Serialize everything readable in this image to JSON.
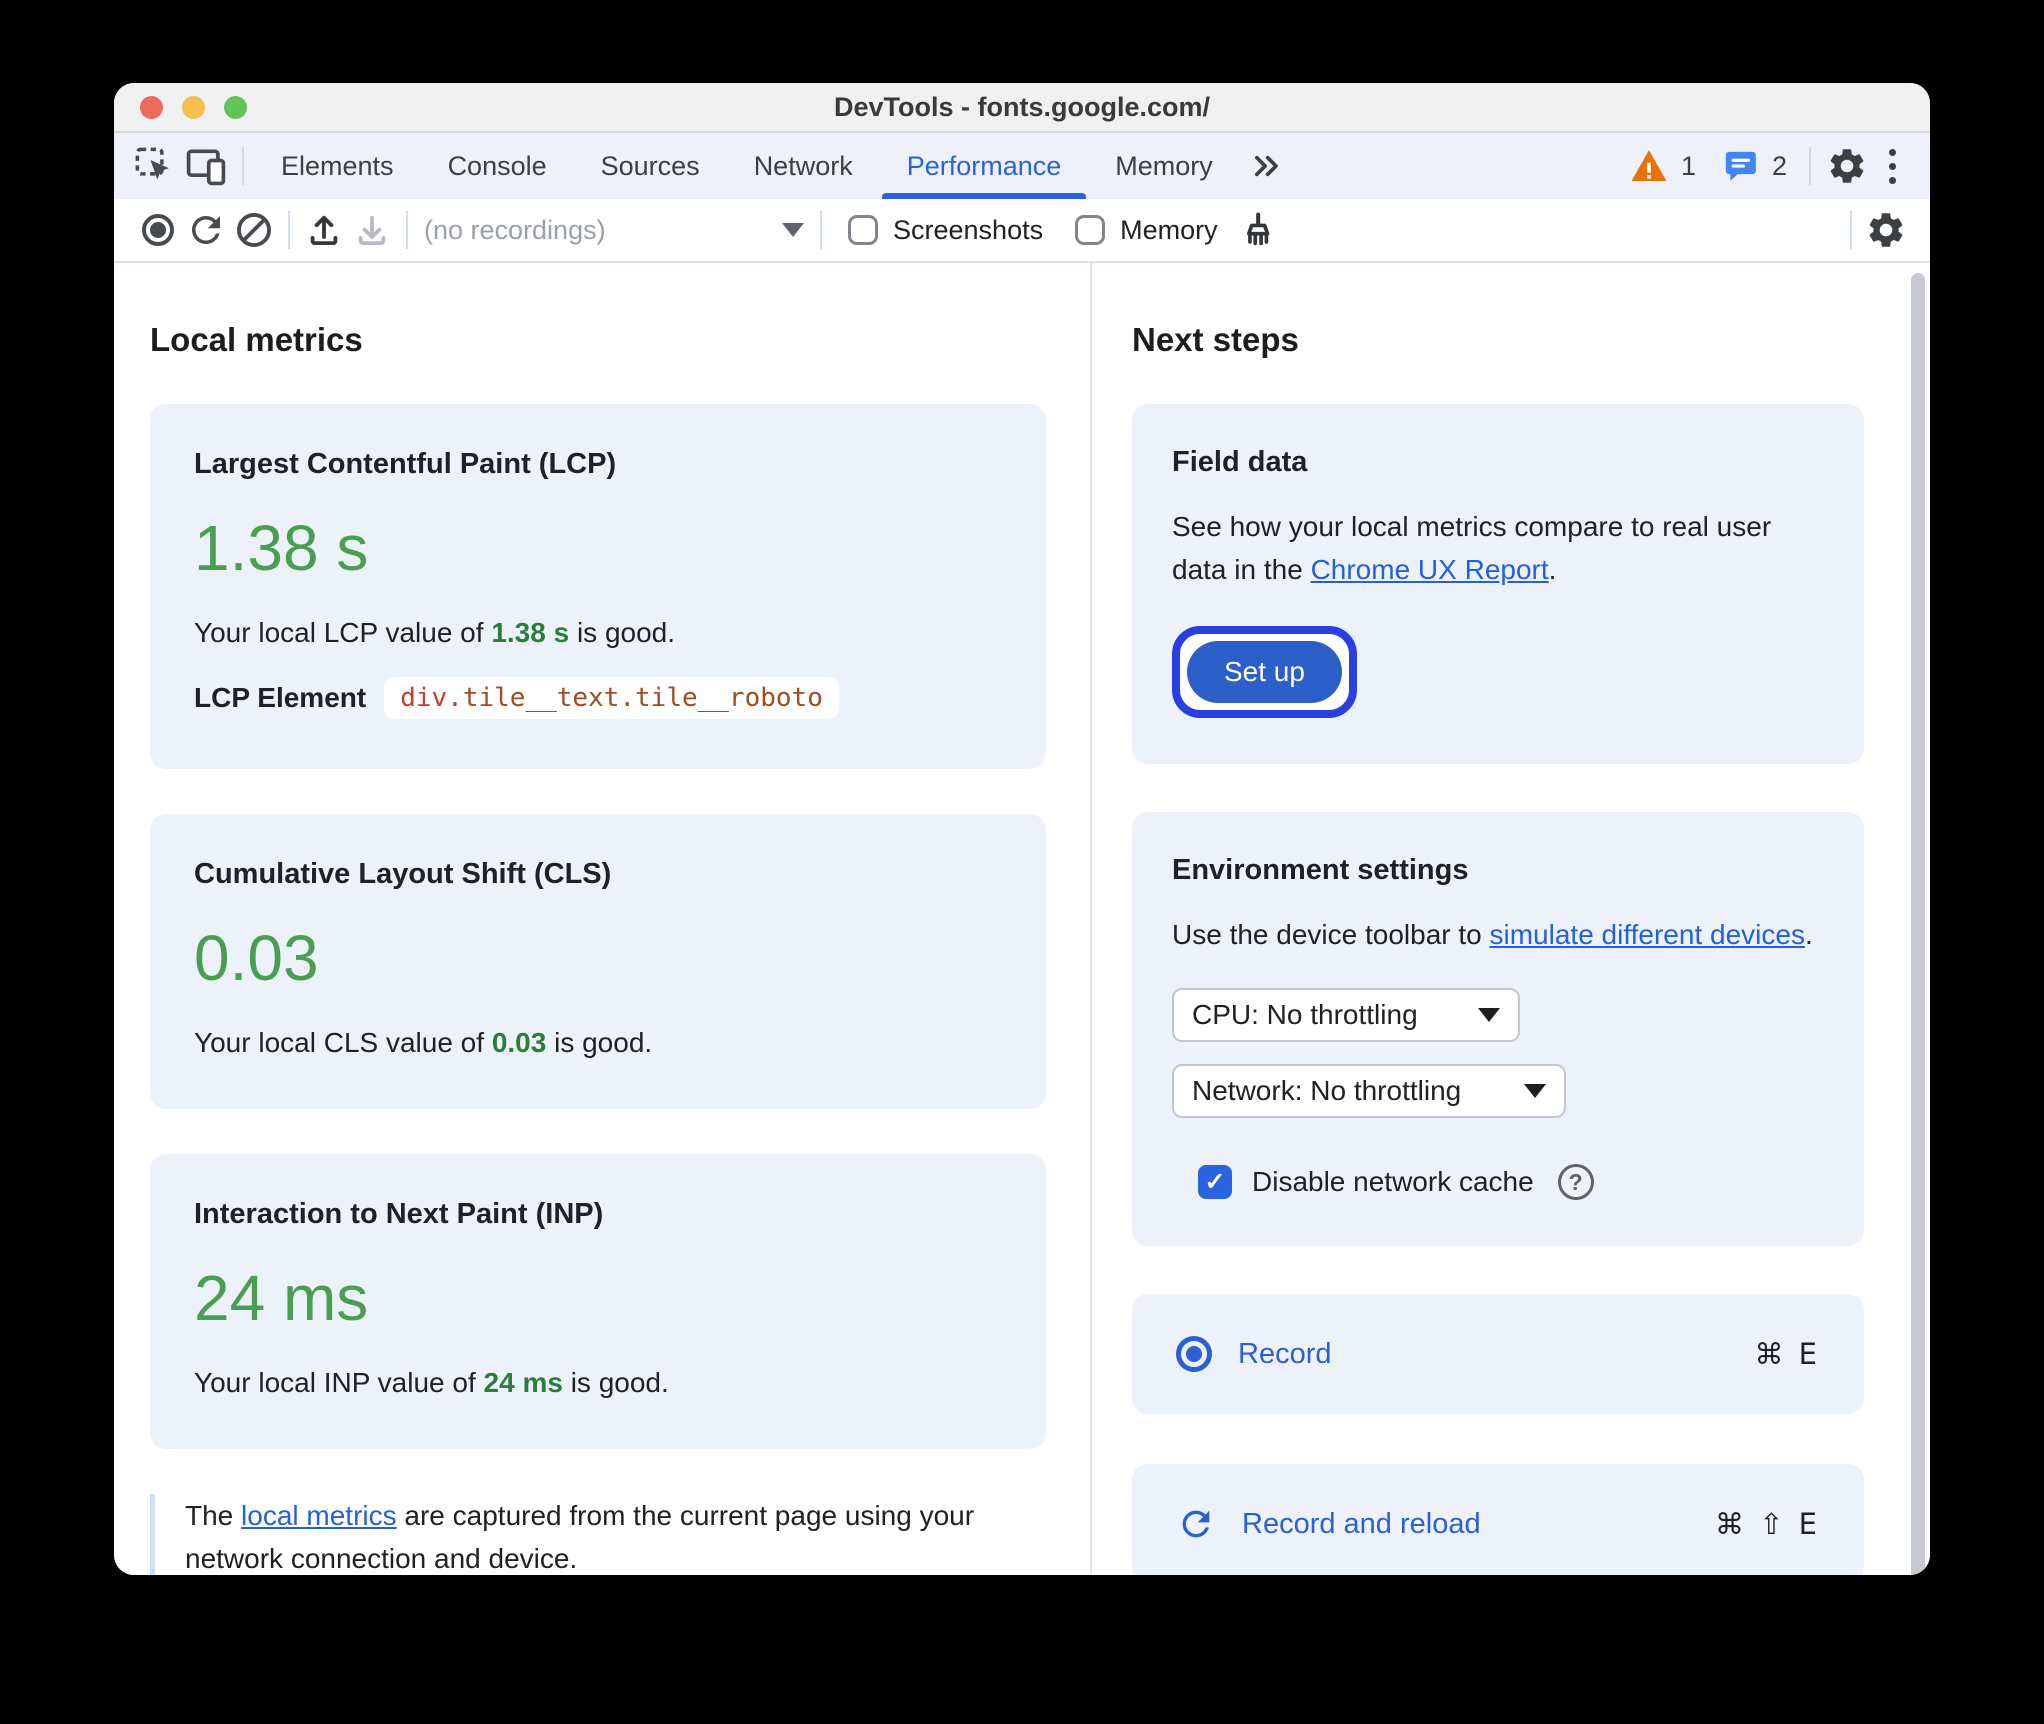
{
  "colors": {
    "tab_blue": "#2b62e0",
    "link_blue": "#2360e0",
    "action_blue": "#2c5fd0",
    "button_blue": "#2d5fc8",
    "focus_ring": "#2840e0",
    "value_green": "#4a9e52",
    "inline_green": "#2d7d3a",
    "warning_orange": "#e8710a",
    "issue_blue": "#4285f4",
    "selector_tag": "#c53e36",
    "selector_class": "#a04d21",
    "checkbox_blue": "#2a64e0",
    "card_bg": "#edf2fa"
  },
  "window": {
    "title": "DevTools - fonts.google.com/"
  },
  "tabbar": {
    "tabs": [
      {
        "label": "Elements"
      },
      {
        "label": "Console"
      },
      {
        "label": "Sources"
      },
      {
        "label": "Network"
      },
      {
        "label": "Performance"
      },
      {
        "label": "Memory"
      }
    ],
    "warning_count": "1",
    "issue_count": "2"
  },
  "toolbar": {
    "recordings_placeholder": "(no recordings)",
    "screenshots_label": "Screenshots",
    "memory_label": "Memory"
  },
  "icons": {
    "help_glyph": "?",
    "check_glyph": "✓"
  },
  "local_metrics": {
    "heading": "Local metrics",
    "lcp": {
      "title": "Largest Contentful Paint (LCP)",
      "value": "1.38 s",
      "sentence_pre": "Your local LCP value of ",
      "sentence_value": "1.38 s",
      "sentence_post": " is good.",
      "element_label": "LCP Element",
      "element_tag": "div",
      "element_classes": ".tile__text.tile__roboto"
    },
    "cls": {
      "title": "Cumulative Layout Shift (CLS)",
      "value": "0.03",
      "sentence_pre": "Your local CLS value of ",
      "sentence_value": "0.03",
      "sentence_post": " is good."
    },
    "inp": {
      "title": "Interaction to Next Paint (INP)",
      "value": "24 ms",
      "sentence_pre": "Your local INP value of ",
      "sentence_value": "24 ms",
      "sentence_post": " is good."
    },
    "note_pre": "The ",
    "note_link": "local metrics",
    "note_post": " are captured from the current page using your network connection and device."
  },
  "next_steps": {
    "heading": "Next steps",
    "field_data": {
      "title": "Field data",
      "text_pre": "See how your local metrics compare to real user data in the ",
      "text_link": "Chrome UX Report",
      "text_post": ".",
      "button_label": "Set up"
    },
    "environment": {
      "title": "Environment settings",
      "text_pre": "Use the device toolbar to ",
      "text_link": "simulate different devices",
      "text_post": ".",
      "cpu_select": "CPU: No throttling",
      "network_select": "Network: No throttling",
      "cache_label": "Disable network cache"
    },
    "record": {
      "label": "Record",
      "shortcut": "⌘ E"
    },
    "record_reload": {
      "label": "Record and reload",
      "shortcut": "⌘ ⇧ E"
    }
  }
}
